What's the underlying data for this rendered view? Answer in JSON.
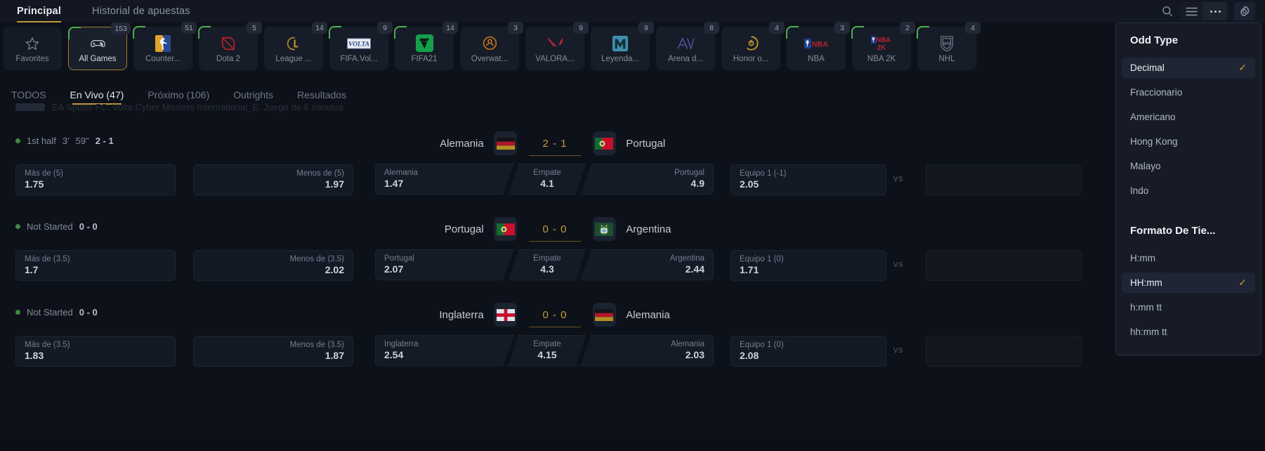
{
  "topbar": {
    "tabs": [
      {
        "label": "Principal",
        "active": true
      },
      {
        "label": "Historial de apuestas",
        "active": false
      }
    ],
    "icons": [
      {
        "name": "search-icon",
        "glyph": "search"
      },
      {
        "name": "list-view-icon",
        "glyph": "list"
      },
      {
        "name": "more-options-icon",
        "glyph": "dots"
      },
      {
        "name": "settings-gear-icon",
        "glyph": "gear"
      }
    ]
  },
  "sports": [
    {
      "label": "Favorites",
      "badge": "",
      "icon": "star-icon",
      "active": false,
      "live": false
    },
    {
      "label": "All Games",
      "badge": "153",
      "icon": "gamepad-icon",
      "active": true,
      "live": true
    },
    {
      "label": "Counter...",
      "badge": "51",
      "icon": "csgo-icon",
      "active": false,
      "live": true
    },
    {
      "label": "Dota 2",
      "badge": "5",
      "icon": "dota2-icon",
      "active": false,
      "live": true
    },
    {
      "label": "League ...",
      "badge": "14",
      "icon": "lol-icon",
      "active": false,
      "live": false
    },
    {
      "label": "FIFA.Vol...",
      "badge": "9",
      "icon": "fifa-volta-icon",
      "active": false,
      "live": true
    },
    {
      "label": "FIFA21",
      "badge": "14",
      "icon": "fifa21-icon",
      "active": false,
      "live": true
    },
    {
      "label": "Overwat...",
      "badge": "3",
      "icon": "overwatch-icon",
      "active": false,
      "live": false
    },
    {
      "label": "VALORA...",
      "badge": "9",
      "icon": "valorant-icon",
      "active": false,
      "live": false
    },
    {
      "label": "Leyenda...",
      "badge": "9",
      "icon": "mobile-legends-icon",
      "active": false,
      "live": false
    },
    {
      "label": "Arena d...",
      "badge": "8",
      "icon": "arena-valor-icon",
      "active": false,
      "live": false
    },
    {
      "label": "Honor o...",
      "badge": "4",
      "icon": "honor-of-kings-icon",
      "active": false,
      "live": false
    },
    {
      "label": "NBA",
      "badge": "3",
      "icon": "nba-icon",
      "active": false,
      "live": true
    },
    {
      "label": "NBA 2K",
      "badge": "2",
      "icon": "nba2k-icon",
      "active": false,
      "live": true
    },
    {
      "label": "NHL",
      "badge": "4",
      "icon": "nhl-icon",
      "active": false,
      "live": true
    }
  ],
  "subtabs": [
    {
      "label": "TODOS",
      "active": false
    },
    {
      "label": "En Vivo (47)",
      "active": true
    },
    {
      "label": "Próximo (106)",
      "active": false
    },
    {
      "label": "Outrights",
      "active": false
    },
    {
      "label": "Resultados",
      "active": false
    }
  ],
  "league_header": "EA Sports FC: Volta Cyber Masters International_E: Juego de 6 minutos",
  "matches": [
    {
      "status": "1st half",
      "minute": "3'",
      "second": "59\"",
      "score_text": "2 - 1",
      "home": "Alemania",
      "away": "Portugal",
      "home_flag": "germany",
      "away_flag": "portugal",
      "score": "2 - 1",
      "over": {
        "label": "Más de (5)",
        "value": "1.75"
      },
      "under": {
        "label": "Menos de (5)",
        "value": "1.97"
      },
      "one": {
        "label": "Alemania",
        "value": "1.47"
      },
      "draw": {
        "label": "Empate",
        "value": "4.1"
      },
      "two": {
        "label": "Portugal",
        "value": "4.9"
      },
      "hcp": {
        "label": "Equipo 1 (-1)",
        "value": "2.05"
      },
      "vs": "vs"
    },
    {
      "status": "Not Started",
      "minute": "",
      "second": "",
      "score_text": "0 - 0",
      "home": "Portugal",
      "away": "Argentina",
      "home_flag": "portugal",
      "away_flag": "argentina",
      "score": "0 - 0",
      "over": {
        "label": "Más de (3.5)",
        "value": "1.7"
      },
      "under": {
        "label": "Menos de (3.5)",
        "value": "2.02"
      },
      "one": {
        "label": "Portugal",
        "value": "2.07"
      },
      "draw": {
        "label": "Empate",
        "value": "4.3"
      },
      "two": {
        "label": "Argentina",
        "value": "2.44"
      },
      "hcp": {
        "label": "Equipo 1 (0)",
        "value": "1.71"
      },
      "vs": "vs"
    },
    {
      "status": "Not Started",
      "minute": "",
      "second": "",
      "score_text": "0 - 0",
      "home": "Inglaterra",
      "away": "Alemania",
      "home_flag": "england",
      "away_flag": "germany",
      "score": "0 - 0",
      "over": {
        "label": "Más de (3.5)",
        "value": "1.83"
      },
      "under": {
        "label": "Menos de (3.5)",
        "value": "1.87"
      },
      "one": {
        "label": "Inglaterra",
        "value": "2.54"
      },
      "draw": {
        "label": "Empate",
        "value": "4.15"
      },
      "two": {
        "label": "Alemania",
        "value": "2.03"
      },
      "hcp": {
        "label": "Equipo 1 (0)",
        "value": "2.08"
      },
      "vs": "vs"
    }
  ],
  "settings_panel": {
    "odd_type_title": "Odd Type",
    "odd_types": [
      {
        "label": "Decimal",
        "selected": true
      },
      {
        "label": "Fraccionario",
        "selected": false
      },
      {
        "label": "Americano",
        "selected": false
      },
      {
        "label": "Hong Kong",
        "selected": false
      },
      {
        "label": "Malayo",
        "selected": false
      },
      {
        "label": "Indo",
        "selected": false
      }
    ],
    "time_format_title": "Formato De Tie...",
    "time_formats": [
      {
        "label": "H:mm",
        "selected": false
      },
      {
        "label": "HH:mm",
        "selected": true
      },
      {
        "label": "h:mm tt",
        "selected": false
      },
      {
        "label": "hh:mm tt",
        "selected": false
      }
    ],
    "check_glyph": "✓"
  },
  "colors": {
    "accent": "#bf9a3a",
    "bg": "#0d1119",
    "panel_bg": "#161b26",
    "live": "#4caf50"
  }
}
